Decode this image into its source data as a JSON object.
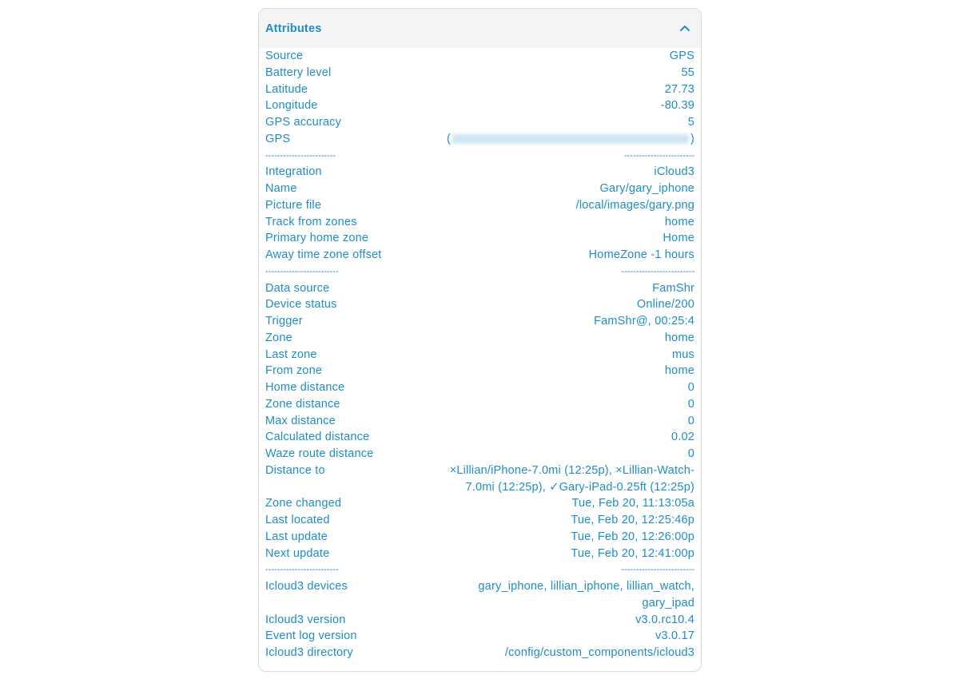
{
  "header": {
    "title": "Attributes",
    "collapse_icon": "chevron-up-icon"
  },
  "colors": {
    "text": "#1e8dc6",
    "header_bg": "#f4f4f4",
    "border": "#d9d9d9"
  },
  "rows": [
    {
      "label": "Source",
      "value": "GPS"
    },
    {
      "label": "Battery level",
      "value": "55"
    },
    {
      "label": "Latitude",
      "value": "27.73"
    },
    {
      "label": "Longitude",
      "value": "-80.39"
    },
    {
      "label": "GPS accuracy",
      "value": "5"
    },
    {
      "label": "GPS",
      "value_open": "(",
      "value_close": ")",
      "blurred": true
    },
    {
      "separator": true,
      "label": "------------------------",
      "value": "------------------------"
    },
    {
      "label": "Integration",
      "value": "iCloud3"
    },
    {
      "label": "Name",
      "value": "Gary/gary_iphone"
    },
    {
      "label": "Picture file",
      "value": "/local/images/gary.png"
    },
    {
      "label": "Track from zones",
      "value": "home"
    },
    {
      "label": "Primary home zone",
      "value": "Home"
    },
    {
      "label": "Away time zone offset",
      "value": "HomeZone -1 hours"
    },
    {
      "separator": true,
      "label": "-------------------------",
      "value": "-------------------------"
    },
    {
      "label": "Data source",
      "value": "FamShr"
    },
    {
      "label": "Device status",
      "value": "Online/200"
    },
    {
      "label": "Trigger",
      "value": "FamShr@, 00:25:4"
    },
    {
      "label": "Zone",
      "value": "home"
    },
    {
      "label": "Last zone",
      "value": "mus"
    },
    {
      "label": "From zone",
      "value": "home"
    },
    {
      "label": "Home distance",
      "value": "0"
    },
    {
      "label": "Zone distance",
      "value": "0"
    },
    {
      "label": "Max distance",
      "value": "0"
    },
    {
      "label": "Calculated distance",
      "value": "0.02"
    },
    {
      "label": "Waze route distance",
      "value": "0"
    },
    {
      "label": "Distance to",
      "value": "×Lillian/iPhone-7.0mi (12:25p), ×Lillian-Watch-7.0mi (12:25p), ✓Gary-iPad-0.25ft (12:25p)"
    },
    {
      "label": "Zone changed",
      "value": "Tue, Feb 20, 11:13:05a"
    },
    {
      "label": "Last located",
      "value": "Tue, Feb 20, 12:25:46p"
    },
    {
      "label": "Last update",
      "value": "Tue, Feb 20, 12:26:00p"
    },
    {
      "label": "Next update",
      "value": "Tue, Feb 20, 12:41:00p"
    },
    {
      "separator": true,
      "label": "-------------------------",
      "value": "-------------------------"
    },
    {
      "label": "Icloud3 devices",
      "value": "gary_iphone, lillian_iphone, lillian_watch, gary_ipad"
    },
    {
      "label": "Icloud3 version",
      "value": "v3.0.rc10.4"
    },
    {
      "label": "Event log version",
      "value": "v3.0.17"
    },
    {
      "label": "Icloud3 directory",
      "value": "/config/custom_components/icloud3"
    }
  ]
}
